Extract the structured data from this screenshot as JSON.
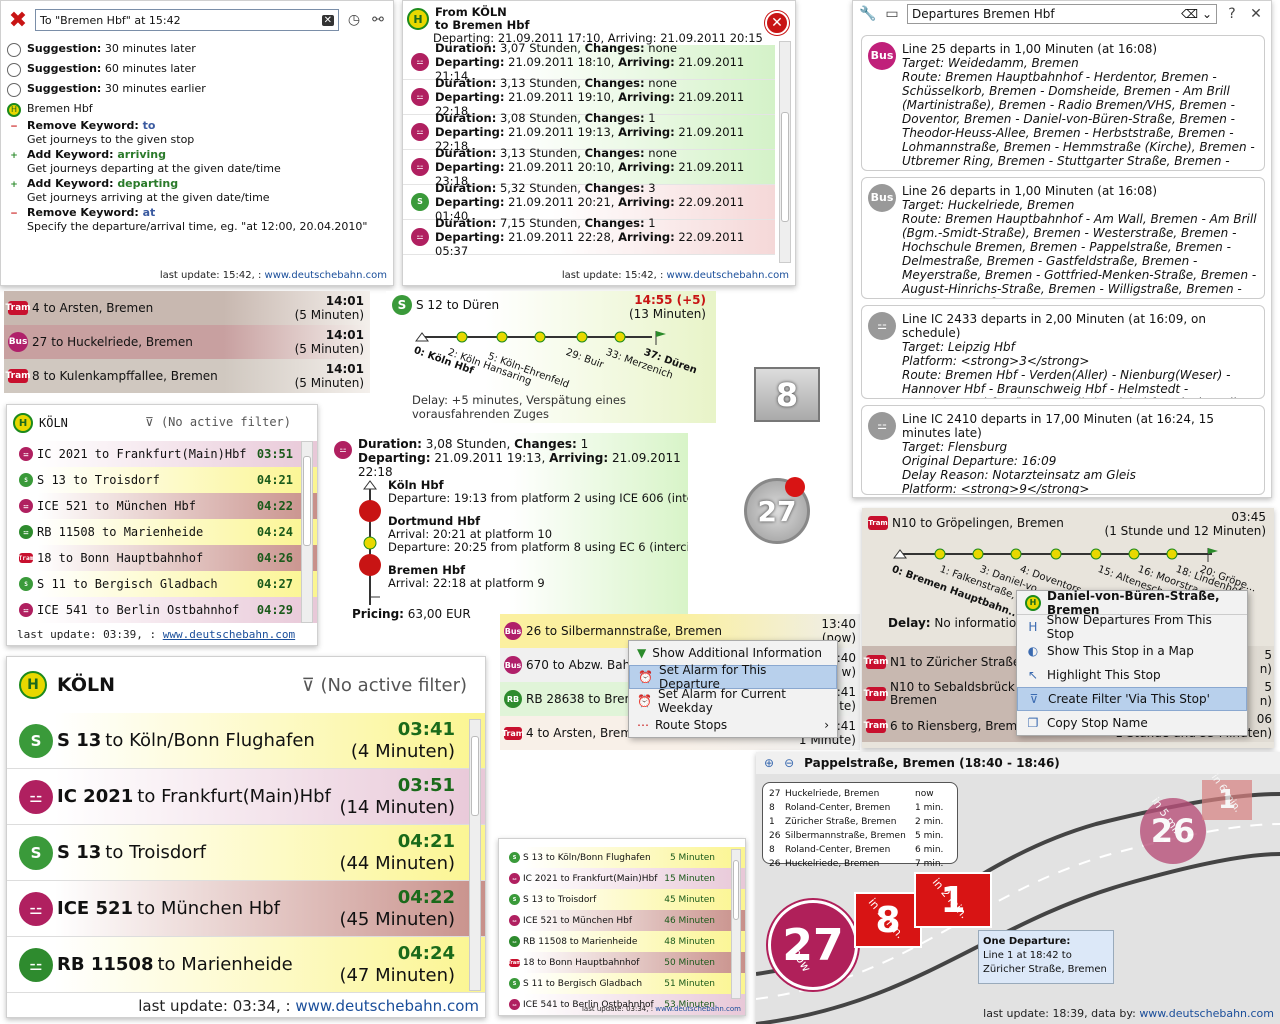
{
  "query_panel": {
    "input_value": "To \"Bremen Hbf\" at 15:42",
    "suggestions": [
      {
        "type": "clock",
        "bold": "Suggestion:",
        "text": " 30 minutes later"
      },
      {
        "type": "clock",
        "bold": "Suggestion:",
        "text": " 60 minutes later"
      },
      {
        "type": "clock",
        "bold": "Suggestion:",
        "text": " 30 minutes earlier"
      }
    ],
    "stop": "Bremen Hbf",
    "keywords": [
      {
        "op": "minus",
        "prefix": "Remove Keyword: ",
        "kw": "to",
        "desc": "Get journeys to the given stop",
        "style": "red"
      },
      {
        "op": "plus",
        "prefix": "Add Keyword: ",
        "kw": "arriving",
        "desc": "Get journeys departing at the given date/time",
        "style": "green"
      },
      {
        "op": "plus",
        "prefix": "Add Keyword: ",
        "kw": "departing",
        "desc": "Get journeys arriving at the given date/time",
        "style": "green"
      },
      {
        "op": "minus",
        "prefix": "Remove Keyword: ",
        "kw": "at",
        "desc": "Specify the departure/arrival time, eg. \"at 12:00, 20.04.2010\"",
        "style": "red"
      }
    ],
    "footer_text": "last update: 15:42, : ",
    "footer_link": "www.deutschebahn.com"
  },
  "journeys_panel": {
    "from": "From KÖLN",
    "to": "to Bremen Hbf",
    "first": "Departing: 21.09.2011 17:10, Arriving: 21.09.2011 20:15",
    "rows": [
      {
        "dur": "3,07 Stunden",
        "chg": "none",
        "dep": "21.09.2011 18:10",
        "arr": "21.09.2011 21:14",
        "bg": "green",
        "icon": "ic"
      },
      {
        "dur": "3,13 Stunden",
        "chg": "none",
        "dep": "21.09.2011 19:10",
        "arr": "21.09.2011 22:18",
        "bg": "green",
        "icon": "ic"
      },
      {
        "dur": "3,08 Stunden",
        "chg": "1",
        "dep": "21.09.2011 19:13",
        "arr": "21.09.2011 22:18",
        "bg": "green",
        "icon": "ic"
      },
      {
        "dur": "3,13 Stunden",
        "chg": "none",
        "dep": "21.09.2011 20:10",
        "arr": "21.09.2011 23:18",
        "bg": "green",
        "icon": "ic"
      },
      {
        "dur": "5,32 Stunden",
        "chg": "3",
        "dep": "21.09.2011 20:21",
        "arr": "22.09.2011 01:40",
        "bg": "red",
        "icon": "s"
      },
      {
        "dur": "7,15 Stunden",
        "chg": "1",
        "dep": "21.09.2011 22:28",
        "arr": "22.09.2011 05:37",
        "bg": "red",
        "icon": "ic"
      }
    ],
    "footer_text": "last update: 15:42, : ",
    "footer_link": "www.deutschebahn.com"
  },
  "bremen_panel": {
    "title": "Departures Bremen Hbf",
    "cards": [
      {
        "icon": "Bus",
        "icon_color": "#c0207a",
        "head": "Line 25 departs in 1,00 Minuten (at 16:08)",
        "target": "Target: Weidedamm, Bremen",
        "body": "Route: Bremen Hauptbahnhof - Herdentor, Bremen - Schüsselkorb, Bremen - Domsheide, Bremen - Am Brill (Martinistraße), Bremen - Radio Bremen/VHS, Bremen - Doventor, Bremen - Daniel-von-Büren-Straße, Bremen - Theodor-Heuss-Allee, Bremen - Herbststraße, Bremen - Lohmannstraße, Bremen - Hemmstraße (Kirche), Bremen - Utbremer Ring, Bremen - Stuttgarter Straße, Bremen -"
      },
      {
        "icon": "Bus",
        "icon_color": "#999",
        "head": "Line 26 departs in 1,00 Minuten (at 16:08)",
        "target": "Target: Huckelriede, Bremen",
        "body": "Route: Bremen Hauptbahnhof - Am Wall, Bremen - Am Brill (Bgm.-Smidt-Straße), Bremen - Westerstraße, Bremen - Hochschule Bremen, Bremen - Pappelstraße, Bremen - Delmestraße, Bremen - Gastfeldstraße, Bremen - Meyerstraße, Bremen - Gottfried-Menken-Straße, Bremen - August-Hinrichs-Straße, Bremen - Willigstraße, Bremen - Stenumer Straße,"
      },
      {
        "icon": "IC",
        "icon_color": "#999",
        "head": "Line IC 2433 departs in 2,00 Minuten (at 16:09, on schedule)",
        "target": "Target: Leipzig Hbf",
        "body": "Platform: <strong>3</strong>\nRoute: Bremen Hbf - Verden(Aller) - Nienburg(Weser) - Hannover Hbf - Braunschweig Hbf - Helmstedt - Magdeburg Hbf - Köthen - Halle(Saale)Hbf - Leipzig/Halle Flughafen - Leipzig Hbf"
      },
      {
        "icon": "IC",
        "icon_color": "#999",
        "head": "Line IC 2410 departs in 17,00 Minuten (at 16:24, 15 minutes late)",
        "target": "Target: Flensburg",
        "body": "Original Departure: 16:09\nDelay Reason:  Notarzteinsatz am Gleis\nPlatform: <strong>9</strong>\nRoute: Bremen Hbf - Hamburg-Harburg - Hamburg Hbf -"
      }
    ]
  },
  "tram_list": [
    {
      "icon": "Tram",
      "line": "4",
      "to": "to Arsten, Bremen",
      "time": "14:01",
      "rel": "(5 Minuten)",
      "bg": "#c8b8b0"
    },
    {
      "icon": "Bus",
      "line": "27",
      "to": "to Huckelriede, Bremen",
      "time": "14:01",
      "rel": "(5 Minuten)",
      "bg": "#c8a0a0"
    },
    {
      "icon": "Tram",
      "line": "8",
      "to": "to Kulenkampffallee, Bremen",
      "time": "14:01",
      "rel": "(5 Minuten)",
      "bg": "#d0c8c0"
    }
  ],
  "s12": {
    "line": "S 12",
    "to": "to Düren",
    "time": "14:55 (+5)",
    "rel": "(13 Minuten)",
    "stops": [
      "0: Köln Hbf",
      "2: Köln Hansaring",
      "5: Köln-Ehrenfeld",
      "29: Buir",
      "33: Merzenich",
      "37: Düren"
    ],
    "delay_label": "Delay:",
    "delay": " +5 minutes, Verspätung eines vorausfahrenden Zuges"
  },
  "badges": {
    "eight": "8",
    "twentyseven": "27"
  },
  "koln_small": {
    "title": "KÖLN",
    "filter": "(No active filter)",
    "rows": [
      {
        "icon": "ic",
        "text": "IC 2021 to Frankfurt(Main)Hbf",
        "time": "03:51",
        "bg": "pnk"
      },
      {
        "icon": "s",
        "text": "S 13 to Troisdorf",
        "time": "04:21",
        "bg": "yel"
      },
      {
        "icon": "ic",
        "text": "ICE 521 to München Hbf",
        "time": "04:22",
        "bg": "brn"
      },
      {
        "icon": "rb",
        "text": "RB 11508 to Marienheide",
        "time": "04:24",
        "bg": "yel"
      },
      {
        "icon": "tram",
        "text": "18 to Bonn Hauptbahnhof",
        "time": "04:26",
        "bg": "brn"
      },
      {
        "icon": "s",
        "text": "S 11 to Bergisch Gladbach",
        "time": "04:27",
        "bg": "yel"
      },
      {
        "icon": "ic",
        "text": "ICE 541 to Berlin Ostbahnhof",
        "time": "04:29",
        "bg": "pnk"
      }
    ],
    "footer_text": "last update: 03:39, : ",
    "footer_link": "www.deutschebahn.com"
  },
  "koln_big": {
    "title": "KÖLN",
    "filter": "(No active filter)",
    "rows": [
      {
        "icon": "s",
        "line": "S 13",
        "to": " to Köln/Bonn Flughafen",
        "time": "03:41",
        "rel": "(4 Minuten)",
        "bg": "yel"
      },
      {
        "icon": "ic",
        "line": "IC 2021",
        "to": " to Frankfurt(Main)Hbf",
        "time": "03:51",
        "rel": "(14 Minuten)",
        "bg": "pnk"
      },
      {
        "icon": "s",
        "line": "S 13",
        "to": " to Troisdorf",
        "time": "04:21",
        "rel": "(44 Minuten)",
        "bg": "yel"
      },
      {
        "icon": "ice",
        "line": "ICE 521",
        "to": " to München Hbf",
        "time": "04:22",
        "rel": "(45 Minuten)",
        "bg": "brn"
      },
      {
        "icon": "rb",
        "line": "RB 11508",
        "to": " to Marienheide",
        "time": "04:24",
        "rel": "(47 Minuten)",
        "bg": "yel"
      }
    ],
    "footer_text": "last update: 03:34, : ",
    "footer_link": "www.deutschebahn.com"
  },
  "journey_detail": {
    "duration": "3,08 Stunden",
    "changes": "1",
    "dep": "21.09.2011 19:13",
    "arr": "21.09.2011 22:18",
    "s1": "Köln Hbf",
    "s1_line": "Departure: 19:13 from platform 2 using ICE 606 (interci",
    "s2": "Dortmund Hbf",
    "s2_arr": "Arrival: 20:21 at platform 10",
    "s2_dep": "Departure: 20:25 from platform 8 using EC 6 (intercity /",
    "s3": "Bremen Hbf",
    "s3_arr": "Arrival: 22:18 at platform 9",
    "pricing_label": "Pricing:",
    "pricing": " 63,00 EUR"
  },
  "dep26": {
    "rows": [
      {
        "icon": "Bus",
        "text": "26 to Silbermannstraße, Bremen",
        "time": "13:40",
        "rel": "(now)",
        "bg": "#fbf0a0"
      },
      {
        "icon": "Bus",
        "text": "670 to Abzw. Bahnh",
        "time": ":40",
        "rel": "w)",
        "bg": "#f0f0f0"
      },
      {
        "icon": "RB",
        "text": "RB 28638 to Bremen",
        "time": ":41",
        "rel": "te)",
        "bg": "#e0f4d8"
      },
      {
        "icon": "Tram",
        "text": "4 to Arsten, Bremen",
        "time": ":41",
        "rel": "1 Minute)",
        "bg": "#f8f0e8"
      }
    ]
  },
  "menu1": [
    "Show Additional Information",
    "Set Alarm for This Departure",
    "Set Alarm for Current Weekday",
    "Route Stops"
  ],
  "n10": {
    "line": "N10",
    "to": "to Gröpelingen, Bremen",
    "time": "03:45",
    "rel": "(1 Stunde und 12 Minuten)",
    "stops": [
      "0: Bremen Hauptbahn...",
      "1: Falkenstraße, B...",
      "3: Daniel-vo...",
      "4: Doventors...",
      "15: Altenesch...",
      "16: Moorstra...",
      "18: Lindenhof...",
      "20: Gröpe..."
    ],
    "delay_label": "Delay:",
    "delay": " No information a",
    "rows": [
      {
        "icon": "Tram",
        "text": "N1 to Züricher Straße, B",
        "tm": "5",
        "rel": "n)"
      },
      {
        "icon": "Tram",
        "text": "N10 to Sebaldsbrück (",
        "text2": "Bremen",
        "tm": "5",
        "rel": "n)"
      },
      {
        "icon": "Tram",
        "text": "6 to Riensberg, Bremen",
        "tm": "06",
        "rel": "1 Stunde und 33 Minuten)"
      }
    ]
  },
  "menu2": {
    "header": "Daniel-von-Büren-Straße, Bremen",
    "items": [
      "Show Departures From This Stop",
      "Show This Stop in a Map",
      "Highlight This Stop",
      "Create Filter 'Via This Stop'",
      "Copy Stop Name"
    ]
  },
  "map": {
    "title": "Pappelstraße, Bremen (18:40 - 18:46)",
    "list": [
      {
        "l": "27",
        "d": "Huckelriede, Bremen",
        "t": "now"
      },
      {
        "l": "8",
        "d": "Roland-Center, Bremen",
        "t": "1 min."
      },
      {
        "l": "1",
        "d": "Züricher Straße, Bremen",
        "t": "2 min."
      },
      {
        "l": "26",
        "d": "Silbermannstraße, Bremen",
        "t": "5 min."
      },
      {
        "l": "8",
        "d": "Roland-Center, Bremen",
        "t": "6 min."
      },
      {
        "l": "26",
        "d": "Huckelriede, Bremen",
        "t": "7 min."
      }
    ],
    "tooltip_title": "One Departure:",
    "tooltip_body": "Line 1 at 18:42 to Züricher Straße, Bremen",
    "m27": "27",
    "m27_t": "now",
    "m8": "8",
    "m8_t": "in 1 min.",
    "m1": "1",
    "m1_t": "in 2 min.",
    "m26": "26",
    "m26_t": "in 5 min.",
    "m1b": "1",
    "m1b_t": "in 6 min.",
    "footer_text": "last update: 18:39, data by: ",
    "footer_link": "www.deutschebahn.com"
  },
  "small_list": {
    "rows": [
      {
        "icon": "s",
        "text": "S 13 to Köln/Bonn Flughafen",
        "time": "5 Minuten",
        "bg": "yel"
      },
      {
        "icon": "ic",
        "text": "IC 2021 to Frankfurt(Main)Hbf",
        "time": "15 Minuten",
        "bg": "pnk"
      },
      {
        "icon": "s",
        "text": "S 13 to Troisdorf",
        "time": "45 Minuten",
        "bg": "yel"
      },
      {
        "icon": "ic",
        "text": "ICE 521 to München Hbf",
        "time": "46 Minuten",
        "bg": "brn"
      },
      {
        "icon": "rb",
        "text": "RB 11508 to Marienheide",
        "time": "48 Minuten",
        "bg": "yel"
      },
      {
        "icon": "tram",
        "text": "18 to Bonn Hauptbahnhof",
        "time": "50 Minuten",
        "bg": "brn"
      },
      {
        "icon": "s",
        "text": "S 11 to Bergisch Gladbach",
        "time": "51 Minuten",
        "bg": "yel"
      },
      {
        "icon": "ic",
        "text": "ICE 541 to Berlin Ostbahnhof",
        "time": "53 Minuten",
        "bg": "pnk"
      }
    ],
    "footer_text": "last update: 03:34, : ",
    "footer_link": "www.deutschebahn.com"
  }
}
